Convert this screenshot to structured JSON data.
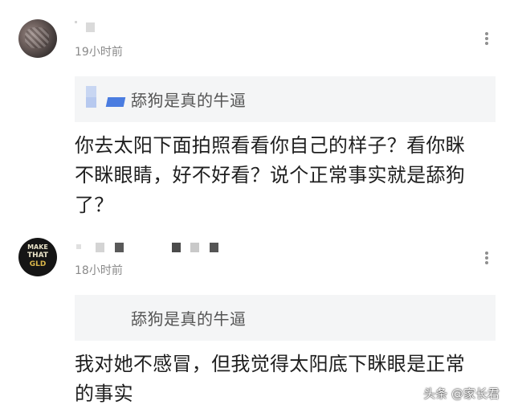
{
  "comments": [
    {
      "time": "19小时前",
      "quote": "舔狗是真的牛逼",
      "lines": [
        "你去太阳下面拍照看看你自己的样子？看你眯",
        "不眯眼睛，好不好看？说个正常事实就是舔狗",
        "了？"
      ]
    },
    {
      "time": "18小时前",
      "quote": "舔狗是真的牛逼",
      "lines": [
        "我对她不感冒，但我觉得太阳底下眯眼是正常",
        "的事实"
      ],
      "avatar_logo": [
        "MAKE",
        "THAT",
        "GLD"
      ]
    }
  ],
  "watermark": "头条 @家长君",
  "colors": {
    "quote_bg": "#f4f5f6",
    "time": "#8a8a8a",
    "text": "#1f1f1f"
  }
}
